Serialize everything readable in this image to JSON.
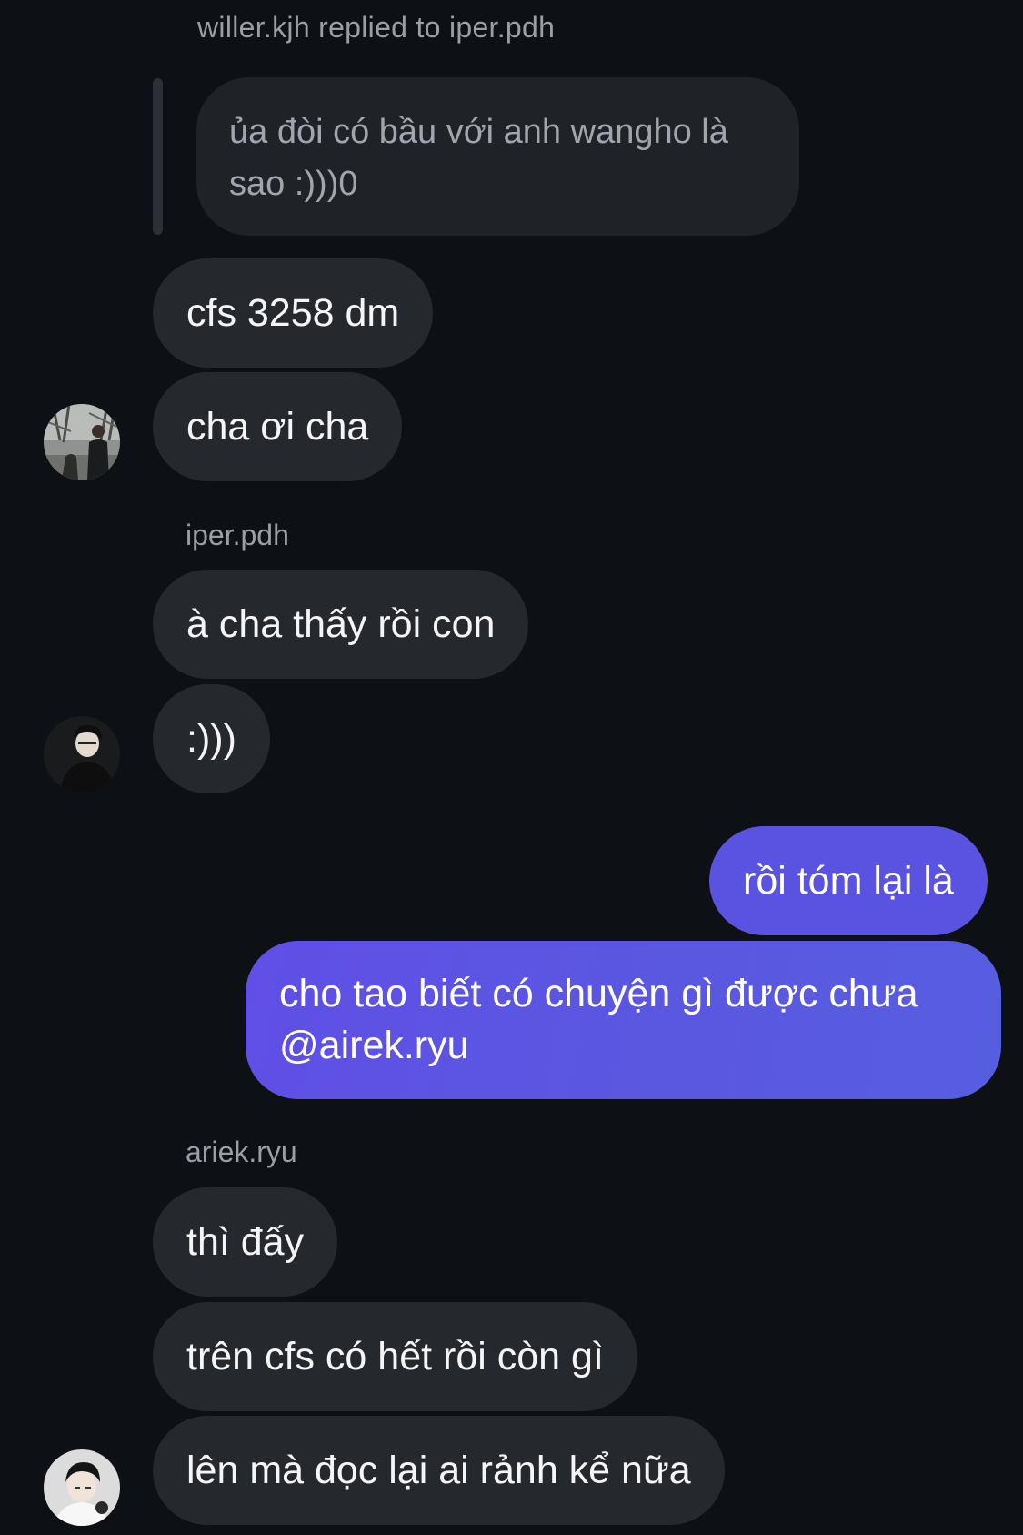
{
  "reply": {
    "header": "willer.kjh replied to iper.pdh",
    "quoted_text": "ủa đòi có bầu với anh wangho là sao :)))0"
  },
  "messages": [
    {
      "id": "m1",
      "text": "cfs 3258 dm"
    },
    {
      "id": "m2",
      "text": "cha ơi cha"
    },
    {
      "id": "m3",
      "text": "à cha thấy rồi con"
    },
    {
      "id": "m4",
      "text": ":)))"
    },
    {
      "id": "m5",
      "text": "rồi tóm lại là"
    },
    {
      "id": "m6",
      "text": "cho tao biết có chuyện gì được chưa @airek.ryu"
    },
    {
      "id": "m7",
      "text": "thì đấy"
    },
    {
      "id": "m8",
      "text": "trên cfs có hết rồi còn gì"
    },
    {
      "id": "m9",
      "text": "lên mà đọc lại ai rảnh kể nữa"
    }
  ],
  "senders": {
    "iper": "iper.pdh",
    "ariek": "ariek.ryu"
  },
  "colors": {
    "background": "#0d1014",
    "incoming_bubble": "#25282d",
    "outgoing_bubble": "#5a52e0",
    "muted_text": "#9b9ea6"
  }
}
